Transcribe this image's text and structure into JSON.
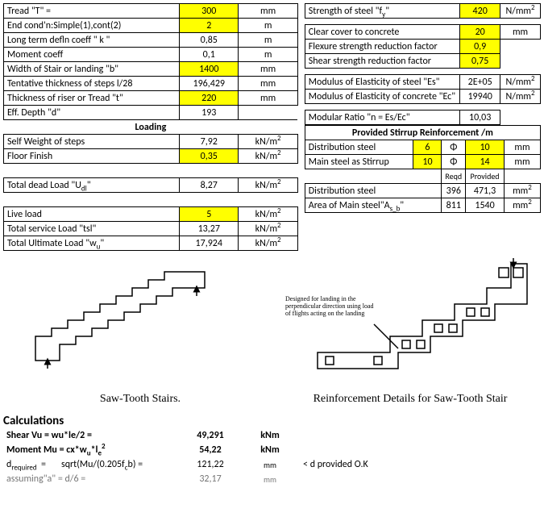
{
  "left_top": {
    "tread_lbl": "Tread \"T\" =",
    "tread_v": "300",
    "tread_u": "mm",
    "end_lbl": "End cond'n:Simple(1),cont(2)",
    "end_v": "2",
    "end_u": "m",
    "defl_lbl": "Long term defln coeff \" k \"",
    "defl_v": "0,85",
    "defl_u": "m",
    "mom_lbl": "Moment coeff",
    "mom_v": "0,1",
    "mom_u": "m",
    "width_lbl": "Width of Stair or landing \"b\"",
    "width_v": "1400",
    "width_u": "mm",
    "tent_lbl": "Tentative thickness of steps l/28",
    "tent_v": "196,429",
    "tent_u": "mm",
    "riser_lbl": "Thickness of riser or Tread \"t\"",
    "riser_v": "220",
    "riser_u": "mm",
    "eff_lbl": "Eff. Depth \"d\"",
    "eff_v": "193",
    "eff_u": "",
    "loading_hdr": "Loading",
    "sw_lbl": "Self Weight of steps",
    "sw_v": "7,92",
    "sw_u": "kN/m",
    "ff_lbl": "Floor Finish",
    "ff_v": "0,35",
    "ff_u": "kN/m",
    "tdl_lbl": "Total dead Load \"U",
    "tdl_v": "8,27",
    "tdl_u": "kN/m",
    "ll_lbl": "Live load",
    "ll_v": "5",
    "ll_u": "kN/m",
    "tsl_lbl": "Total service Load \"tsl\"",
    "tsl_v": "13,27",
    "tsl_u": "kN/m",
    "tul_lbl": "Total Ultimate Load \"w",
    "tul_v": "17,924",
    "tul_u": "kN/m"
  },
  "right_top": {
    "fy_lbl": "Strength of steel \"f",
    "fy_v": "420",
    "fy_u": "N/mm",
    "cc_lbl": "Clear cover to concrete",
    "cc_v": "20",
    "cc_u": "mm",
    "fsr_lbl": "Flexure strength reduction factor",
    "fsr_v": "0,9",
    "ssr_lbl": "Shear strength reduction factor",
    "ssr_v": "0,75",
    "es_lbl": "Modulus of Elasticity of steel \"Es\"",
    "es_v": "2E+05",
    "es_u": "N/mm",
    "ec_lbl": "Modulus of Elasticity of concrete \"Ec\"",
    "ec_v": "19940",
    "ec_u": "N/mm",
    "n_lbl": "Modular Ratio \"n = Es/Ec\"",
    "n_v": "10,03",
    "stir_hdr": "Provided Stirrup Reinforcement /m",
    "dist_lbl": "Distribution steel",
    "dist_n": "6",
    "phi": "Φ",
    "dist_d": "10",
    "dist_u": "mm",
    "main_lbl": "Main steel as Stirrup",
    "main_n": "10",
    "main_d": "14",
    "main_u": "mm",
    "reqd": "Reqd",
    "prov": "Provided",
    "dist2_lbl": "Distribution steel",
    "dist_req": "396",
    "dist_prv": "471,3",
    "dist2_u": "mm",
    "as_lbl": "Area of Main steel\"A",
    "as_req": "811",
    "as_prv": "1540",
    "as_u": "mm"
  },
  "fig": {
    "sawtooth": "Saw-Tooth Stairs.",
    "reinf": "Reinforcement Details for Saw-Tooth Stair",
    "note": "Designed for landing in the perpendicular direction using load of flights acting on the landing"
  },
  "calc": {
    "hdr": "Calculations",
    "shear_lbl": "Shear Vu = wu*le/2 =",
    "shear_v": "49,291",
    "shear_u": "kNm",
    "mom_lbl": "Moment Mu = cx*w",
    "mom_lbl2": "*l",
    "mom_v": "54,22",
    "mom_u": "kNm",
    "dreq_pre": "d",
    "dreq_lbl": "sqrt(Mu/(0.205f",
    "dreq_lbl2": "b) =",
    "dreq_v": "121,22",
    "dreq_u": "mm",
    "dreq_note": "< d provided O.K",
    "ass_lbl": "assuming\"a\" = d/6 =",
    "ass_v": "32,17",
    "ass_u": "mm",
    "req_suffix": "required",
    "eq": "="
  }
}
